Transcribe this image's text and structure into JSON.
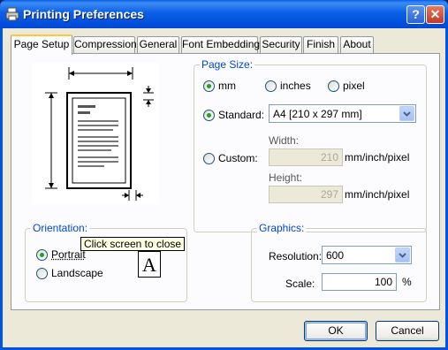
{
  "window": {
    "title": "Printing Preferences"
  },
  "tabs": [
    "Page Setup",
    "Compression",
    "General",
    "Font Embedding",
    "Security",
    "Finish",
    "About"
  ],
  "page_size": {
    "label": "Page Size:",
    "units": [
      "mm",
      "inches",
      "pixel"
    ],
    "standard_label": "Standard:",
    "standard_value": "A4 [210 x 297 mm]",
    "custom_label": "Custom:",
    "width_label": "Width:",
    "width_value": "210",
    "width_unit": "mm/inch/pixel",
    "height_label": "Height:",
    "height_value": "297",
    "height_unit": "mm/inch/pixel"
  },
  "orientation": {
    "label": "Orientation:",
    "portrait": "Portrait",
    "landscape": "Landscape",
    "tooltip": "Click screen to close",
    "icon_letter": "A"
  },
  "graphics": {
    "label": "Graphics:",
    "resolution_label": "Resolution:",
    "resolution_value": "600",
    "scale_label": "Scale:",
    "scale_value": "100",
    "scale_unit": "%"
  },
  "buttons": {
    "ok": "OK",
    "cancel": "Cancel"
  }
}
